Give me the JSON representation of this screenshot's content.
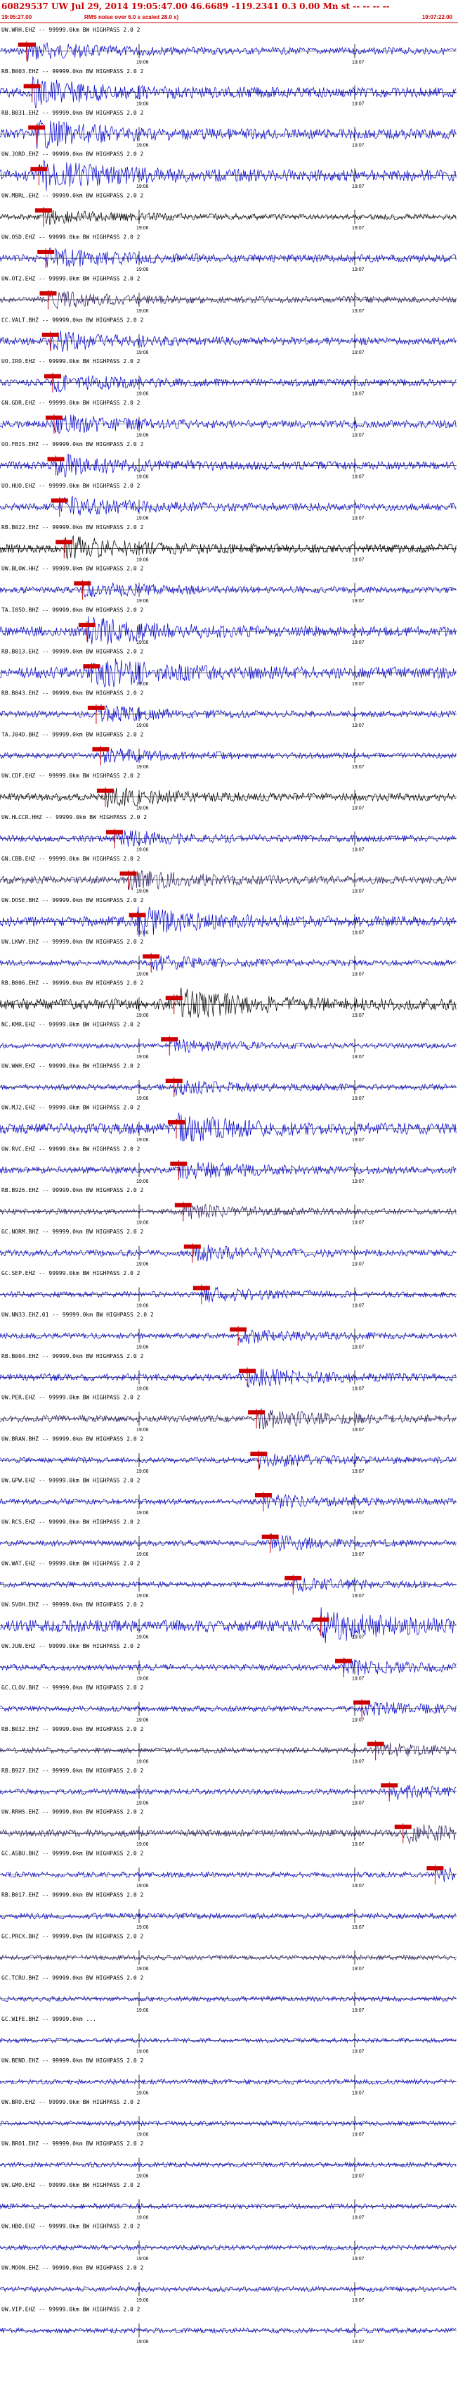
{
  "header": {
    "title": "60829537 UW Jul 29, 2014 19:05:47.00   46.6689 -119.2341  0.3 0.00 Mn st -- -- -- --",
    "start_time": "19:05:27.00",
    "scale_note": "RMS noise over 6.0 s scaled 28.0 x)",
    "end_time": "19:07:22.00"
  },
  "time_ticks": [
    "19:06",
    "19:07"
  ],
  "colors": {
    "blue": "#0000cc",
    "black": "#000000",
    "purple": "#2a1a5e",
    "pick": "#cc0000"
  },
  "channels": [
    {
      "label": "UW.WRH.EHZ -- 99999.0km BW  HIGHPASS  2.0  2",
      "color": "blue",
      "amp": 0.55,
      "pick": 0.058
    },
    {
      "label": "RB.B003.EHZ -- 99999.0km BW  HIGHPASS  2.0  2",
      "color": "blue",
      "amp": 0.8,
      "pick": 0.07
    },
    {
      "label": "RB.B031.EHZ -- 99999.0km BW  HIGHPASS  2.0  2",
      "color": "blue",
      "amp": 0.8,
      "pick": 0.08
    },
    {
      "label": "UW.JORD.EHZ -- 99999.0km BW  HIGHPASS  2.0  2",
      "color": "blue",
      "amp": 0.9,
      "pick": 0.085
    },
    {
      "label": "UW.MBRL.EHZ -- 99999.0km BW  HIGHPASS  2.0  2",
      "color": "black",
      "amp": 0.45,
      "pick": 0.095
    },
    {
      "label": "UW.OSD.EHZ -- 99999.0km BW  HIGHPASS  2.0  2",
      "color": "blue",
      "amp": 0.6,
      "pick": 0.1
    },
    {
      "label": "UW.OT2.EHZ -- 99999.0km BW  HIGHPASS  2.0  2",
      "color": "purple",
      "amp": 0.5,
      "pick": 0.105
    },
    {
      "label": "CC.VALT.BHZ -- 99999.0km BW  HIGHPASS  2.0  2",
      "color": "blue",
      "amp": 0.6,
      "pick": 0.11
    },
    {
      "label": "UO.IRO.EHZ -- 99999.0km BW  HIGHPASS  2.0  2",
      "color": "blue",
      "amp": 0.55,
      "pick": 0.115
    },
    {
      "label": "GN.GDR.EHZ -- 99999.0km BW  HIGHPASS  2.0  2",
      "color": "blue",
      "amp": 0.6,
      "pick": 0.118
    },
    {
      "label": "UO.FBIS.EHZ -- 99999.0km BW  HIGHPASS  2.0  2",
      "color": "blue",
      "amp": 0.65,
      "pick": 0.122
    },
    {
      "label": "UO.HUO.EHZ -- 99999.0km BW  HIGHPASS  2.0  2",
      "color": "blue",
      "amp": 0.6,
      "pick": 0.13
    },
    {
      "label": "RB.B022.EHZ -- 99999.0km BW  HIGHPASS  2.0  2",
      "color": "black",
      "amp": 0.7,
      "pick": 0.14
    },
    {
      "label": "UW.BLOW.HHZ -- 99999.0km BW  HIGHPASS  2.0  2",
      "color": "blue",
      "amp": 0.5,
      "pick": 0.18
    },
    {
      "label": "TA.I05D.BHZ -- 99999.0km BW  HIGHPASS  2.0  2",
      "color": "blue",
      "amp": 0.8,
      "pick": 0.19
    },
    {
      "label": "RB.B013.EHZ -- 99999.0km BW  HIGHPASS  2.0  2",
      "color": "blue",
      "amp": 0.9,
      "pick": 0.2
    },
    {
      "label": "RB.B043.EHZ -- 99999.0km BW  HIGHPASS  2.0  2",
      "color": "blue",
      "amp": 0.5,
      "pick": 0.21
    },
    {
      "label": "TA.J04D.BHZ -- 99999.0km BW  HIGHPASS  2.0  2",
      "color": "blue",
      "amp": 0.45,
      "pick": 0.22
    },
    {
      "label": "UW.CDF.EHZ -- 99999.0km BW  HIGHPASS  2.0  2",
      "color": "black",
      "amp": 0.6,
      "pick": 0.23
    },
    {
      "label": "UW.HLCCR.HHZ -- 99999.0km BW  HIGHPASS  2.0  2",
      "color": "blue",
      "amp": 0.5,
      "pick": 0.25
    },
    {
      "label": "GN.CBB.EHZ -- 99999.0km BW  HIGHPASS  2.0  2",
      "color": "purple",
      "amp": 0.6,
      "pick": 0.28
    },
    {
      "label": "UW.DOSE.BHZ -- 99999.0km BW  HIGHPASS  2.0  2",
      "color": "blue",
      "amp": 0.8,
      "pick": 0.3
    },
    {
      "label": "UW.LKWY.EHZ -- 99999.0km BW  HIGHPASS  2.0  2",
      "color": "blue",
      "amp": 0.45,
      "pick": 0.33
    },
    {
      "label": "RB.B006.EHZ -- 99999.0km BW  HIGHPASS  2.0  2",
      "color": "black",
      "amp": 0.9,
      "pick": 0.38
    },
    {
      "label": "NC.KMR.EHZ -- 99999.0km BW  HIGHPASS  2.0  2",
      "color": "blue",
      "amp": 0.4,
      "pick": 0.37
    },
    {
      "label": "UW.WWH.EHZ -- 99999.0km BW  HIGHPASS  2.0  2",
      "color": "blue",
      "amp": 0.45,
      "pick": 0.38
    },
    {
      "label": "UW.MJ2.EHZ -- 99999.0km BW  HIGHPASS  2.0  2",
      "color": "blue",
      "amp": 0.85,
      "pick": 0.385
    },
    {
      "label": "UW.RVC.EHZ -- 99999.0km BW  HIGHPASS  2.0  2",
      "color": "blue",
      "amp": 0.55,
      "pick": 0.39
    },
    {
      "label": "RB.B926.EHZ -- 99999.0km BW  HIGHPASS  2.0  2",
      "color": "purple",
      "amp": 0.45,
      "pick": 0.4
    },
    {
      "label": "GC.NORM.BHZ -- 99999.0km BW  HIGHPASS  2.0  2",
      "color": "blue",
      "amp": 0.5,
      "pick": 0.42
    },
    {
      "label": "GC.SEP.EHZ -- 99999.0km BW  HIGHPASS  2.0  2",
      "color": "blue",
      "amp": 0.45,
      "pick": 0.44
    },
    {
      "label": "UW.NN33.EHZ.01 -- 99999.0km BW  HIGHPASS  2.0  2",
      "color": "blue",
      "amp": 0.45,
      "pick": 0.52
    },
    {
      "label": "RB.B004.EHZ -- 99999.0km BW  HIGHPASS  2.0  2",
      "color": "blue",
      "amp": 0.55,
      "pick": 0.54
    },
    {
      "label": "UW.PER.EHZ -- 99999.0km BW  HIGHPASS  2.0  2",
      "color": "purple",
      "amp": 0.55,
      "pick": 0.56
    },
    {
      "label": "UW.BRAN.BHZ -- 99999.0km BW  HIGHPASS  2.0  2",
      "color": "blue",
      "amp": 0.45,
      "pick": 0.565
    },
    {
      "label": "UW.GPW.EHZ -- 99999.0km BW  HIGHPASS  2.0  2",
      "color": "blue",
      "amp": 0.45,
      "pick": 0.575
    },
    {
      "label": "UW.RCS.EHZ -- 99999.0km BW  HIGHPASS  2.0  2",
      "color": "blue",
      "amp": 0.45,
      "pick": 0.59
    },
    {
      "label": "UW.WAT.EHZ -- 99999.0km BW  HIGHPASS  2.0  2",
      "color": "blue",
      "amp": 0.45,
      "pick": 0.64
    },
    {
      "label": "UW.SVOH.EHZ -- 99999.0km BW  HIGHPASS  2.0  2",
      "color": "blue",
      "amp": 0.95,
      "pick": 0.7
    },
    {
      "label": "UW.JUN.EHZ -- 99999.0km BW  HIGHPASS  2.0  2",
      "color": "blue",
      "amp": 0.5,
      "pick": 0.75
    },
    {
      "label": "GC.CLOV.BHZ -- 99999.0km BW  HIGHPASS  2.0  2",
      "color": "blue",
      "amp": 0.45,
      "pick": 0.79
    },
    {
      "label": "RB.B032.EHZ -- 99999.0km BW  HIGHPASS  2.0  2",
      "color": "purple",
      "amp": 0.45,
      "pick": 0.82
    },
    {
      "label": "RB.B927.EHZ -- 99999.0km BW  HIGHPASS  2.0  2",
      "color": "blue",
      "amp": 0.45,
      "pick": 0.85
    },
    {
      "label": "UW.RRHS.EHZ -- 99999.0km BW  HIGHPASS  2.0  2",
      "color": "purple",
      "amp": 0.55,
      "pick": 0.88
    },
    {
      "label": "GC.ASBU.BHZ -- 99999.0km BW  HIGHPASS  2.0  2",
      "color": "blue",
      "amp": 0.45,
      "pick": 0.95
    },
    {
      "label": "RB.B017.EHZ -- 99999.0km BW  HIGHPASS  2.0  2",
      "color": "blue",
      "amp": 0.45,
      "pick": null
    },
    {
      "label": "GC.PRCX.BHZ -- 99999.0km BW  HIGHPASS  2.0  2",
      "color": "purple",
      "amp": 0.4,
      "pick": null
    },
    {
      "label": "GC.TCRU.BHZ -- 99999.0km BW  HIGHPASS  2.0  2",
      "color": "blue",
      "amp": 0.4,
      "pick": null
    },
    {
      "label": "GC.WIFE.BHZ -- 99999.0km ...",
      "color": "blue",
      "amp": 0.35,
      "pick": null
    },
    {
      "label": "UW.BEND.EHZ -- 99999.0km BW  HIGHPASS  2.0  2",
      "color": "blue",
      "amp": 0.4,
      "pick": null
    },
    {
      "label": "UW.BRO.EHZ -- 99999.0km BW  HIGHPASS  2.0  2",
      "color": "blue",
      "amp": 0.4,
      "pick": null
    },
    {
      "label": "UW.BRO1.EHZ -- 99999.0km BW  HIGHPASS  2.0  2",
      "color": "blue",
      "amp": 0.4,
      "pick": null
    },
    {
      "label": "UW.GMO.EHZ -- 99999.0km BW  HIGHPASS  2.0  2",
      "color": "blue",
      "amp": 0.4,
      "pick": null
    },
    {
      "label": "UW.HBO.EHZ -- 99999.0km BW  HIGHPASS  2.0  2",
      "color": "blue",
      "amp": 0.4,
      "pick": null
    },
    {
      "label": "UW.MOON.EHZ -- 99999.0km BW  HIGHPASS  2.0  2",
      "color": "blue",
      "amp": 0.4,
      "pick": null
    },
    {
      "label": "UW.VIP.EHZ -- 99999.0km BW  HIGHPASS  2.0  2",
      "color": "blue",
      "amp": 0.4,
      "pick": null
    }
  ]
}
